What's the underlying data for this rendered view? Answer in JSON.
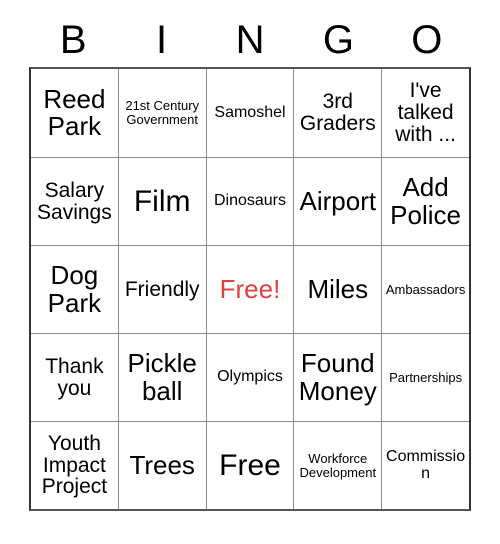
{
  "card": {
    "header_letters": [
      "B",
      "I",
      "N",
      "G",
      "O"
    ],
    "free_color": "#e0433f",
    "grid_line_color": "#8a8a8a",
    "border_color": "#333333",
    "rows": [
      [
        {
          "text": "Reed Park",
          "size": "lg",
          "free": false
        },
        {
          "text": "21st Century Government",
          "size": "xs",
          "free": false
        },
        {
          "text": "Samoshel",
          "size": "sm",
          "free": false
        },
        {
          "text": "3rd Graders",
          "size": "md",
          "free": false
        },
        {
          "text": "I've talked with ...",
          "size": "md",
          "free": false
        }
      ],
      [
        {
          "text": "Salary Savings",
          "size": "md",
          "free": false
        },
        {
          "text": "Film",
          "size": "xl",
          "free": false
        },
        {
          "text": "Dinosaurs",
          "size": "sm",
          "free": false
        },
        {
          "text": "Airport",
          "size": "lg",
          "free": false
        },
        {
          "text": "Add Police",
          "size": "lg",
          "free": false
        }
      ],
      [
        {
          "text": "Dog Park",
          "size": "lg",
          "free": false
        },
        {
          "text": "Friendly",
          "size": "md",
          "free": false
        },
        {
          "text": "Free!",
          "size": "lg",
          "free": true
        },
        {
          "text": "Miles",
          "size": "lg",
          "free": false
        },
        {
          "text": "Ambassadors",
          "size": "xs",
          "free": false
        }
      ],
      [
        {
          "text": "Thank you",
          "size": "md",
          "free": false
        },
        {
          "text": "Pickle ball",
          "size": "lg",
          "free": false
        },
        {
          "text": "Olympics",
          "size": "sm",
          "free": false
        },
        {
          "text": "Found Money",
          "size": "lg",
          "free": false
        },
        {
          "text": "Partnerships",
          "size": "xs",
          "free": false
        }
      ],
      [
        {
          "text": "Youth Impact Project",
          "size": "md",
          "free": false
        },
        {
          "text": "Trees",
          "size": "lg",
          "free": false
        },
        {
          "text": "Free",
          "size": "xl",
          "free": false
        },
        {
          "text": "Workforce Development",
          "size": "xs",
          "free": false
        },
        {
          "text": "Commission",
          "size": "sm",
          "free": false
        }
      ]
    ]
  }
}
